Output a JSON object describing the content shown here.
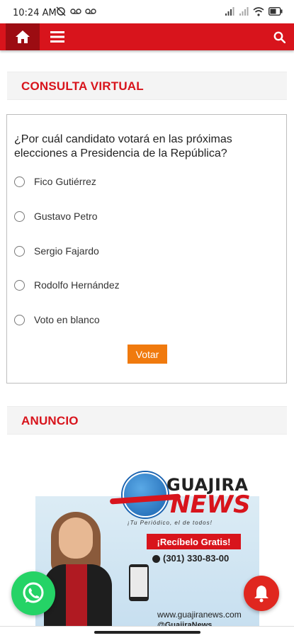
{
  "status_bar": {
    "time": "10:24 AM",
    "left_icons": [
      "alarm-off-icon",
      "voicemail-icon",
      "voicemail-icon"
    ],
    "right_icons": [
      "signal-icon",
      "signal-icon",
      "wifi-icon",
      "battery-icon"
    ]
  },
  "navbar": {
    "color": "#d8141c",
    "home_icon": "home-icon",
    "menu_icon": "menu-icon",
    "search_icon": "search-icon"
  },
  "poll_section": {
    "title": "CONSULTA VIRTUAL",
    "question": "¿Por cuál candidato votará en las próximas elecciones a Presidencia de la República?",
    "options": [
      {
        "label": "Fico Gutiérrez"
      },
      {
        "label": "Gustavo Petro"
      },
      {
        "label": "Sergio Fajardo"
      },
      {
        "label": "Rodolfo Hernández"
      },
      {
        "label": "Voto en blanco"
      }
    ],
    "vote_label": "Votar",
    "vote_color": "#f07a0e"
  },
  "ad_section": {
    "title": "ANUNCIO",
    "brand_line1": "GUAJIRA",
    "brand_line2": "NEWS",
    "slogan": "¡Tu Periódico, el de todos!",
    "cta": "¡Recíbelo Gratis!",
    "phone": "(301) 330-83-00",
    "website": "www.guajiranews.com",
    "handle": "@GuajiraNews"
  },
  "floating": {
    "whatsapp_icon": "whatsapp-icon",
    "notification_icon": "bell-icon"
  }
}
